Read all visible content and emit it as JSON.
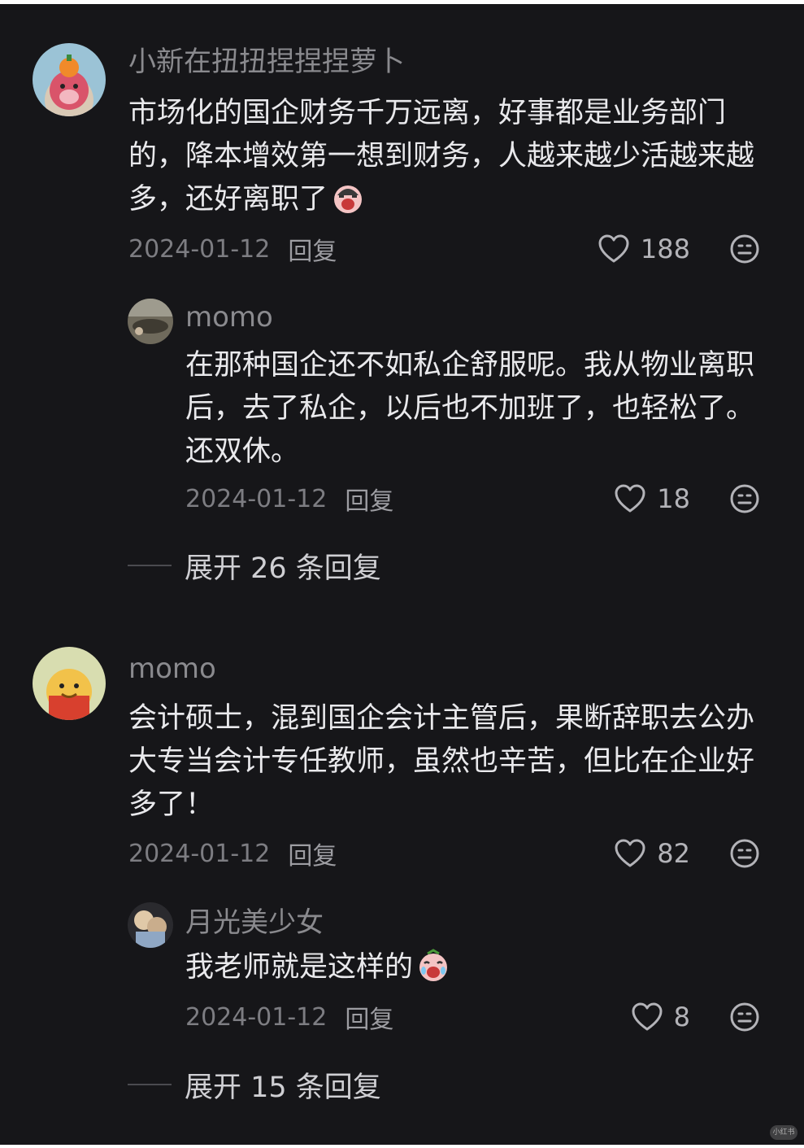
{
  "comments": [
    {
      "username": "小新在扭扭捏捏捏萝卜",
      "text": "市场化的国企财务千万远离，好事都是业务部门的，降本增效第一想到财务，人越来越少活越来越多，还好离职了",
      "emoji": "crying-face-emoji",
      "date": "2024-01-12",
      "reply_label": "回复",
      "likes": "188"
    },
    {
      "username": "momo",
      "text": "在那种国企还不如私企舒服呢。我从物业离职后，去了私企，以后也不加班了，也轻松了。还双休。",
      "date": "2024-01-12",
      "reply_label": "回复",
      "likes": "18"
    },
    {
      "username": "momo",
      "text": "会计硕士，混到国企会计主管后，果断辞职去公办大专当会计专任教师，虽然也辛苦，但比在企业好多了！",
      "date": "2024-01-12",
      "reply_label": "回复",
      "likes": "82"
    },
    {
      "username": "月光美少女",
      "text": "我老师就是这样的",
      "emoji": "crying-face-emoji",
      "date": "2024-01-12",
      "reply_label": "回复",
      "likes": "8"
    }
  ],
  "expand_replies": [
    "展开 26 条回复",
    "展开 15 条回复"
  ],
  "watermark": "小红书",
  "colors": {
    "background": "#161619",
    "text": "#e9e9ec",
    "username": "#8a8a8e",
    "meta": "#7d7d82"
  },
  "icons": {
    "like": "heart-icon",
    "reaction": "emoji-face-icon"
  }
}
